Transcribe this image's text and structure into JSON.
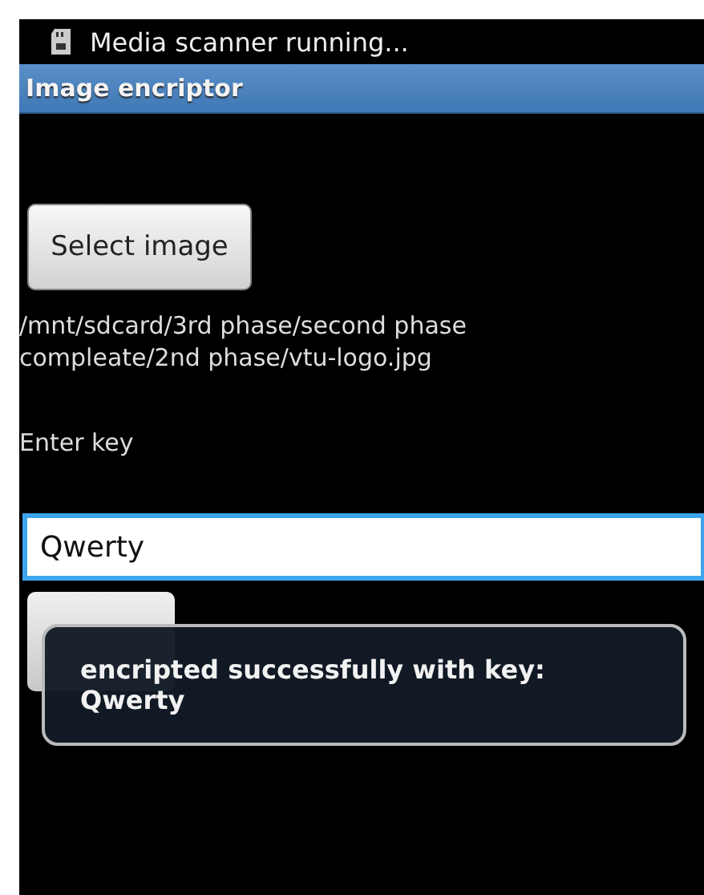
{
  "status_bar": {
    "notification": "Media scanner running..."
  },
  "title_bar": {
    "title": "Image encriptor"
  },
  "select_button": {
    "label": "Select image"
  },
  "file_path": "/mnt/sdcard/3rd phase/second phase compleate/2nd phase/vtu-logo.jpg",
  "key_label": "Enter key",
  "key_field": {
    "value": "Qwerty",
    "focused": true
  },
  "toast": {
    "message": "encripted successfully with key: Qwerty"
  }
}
